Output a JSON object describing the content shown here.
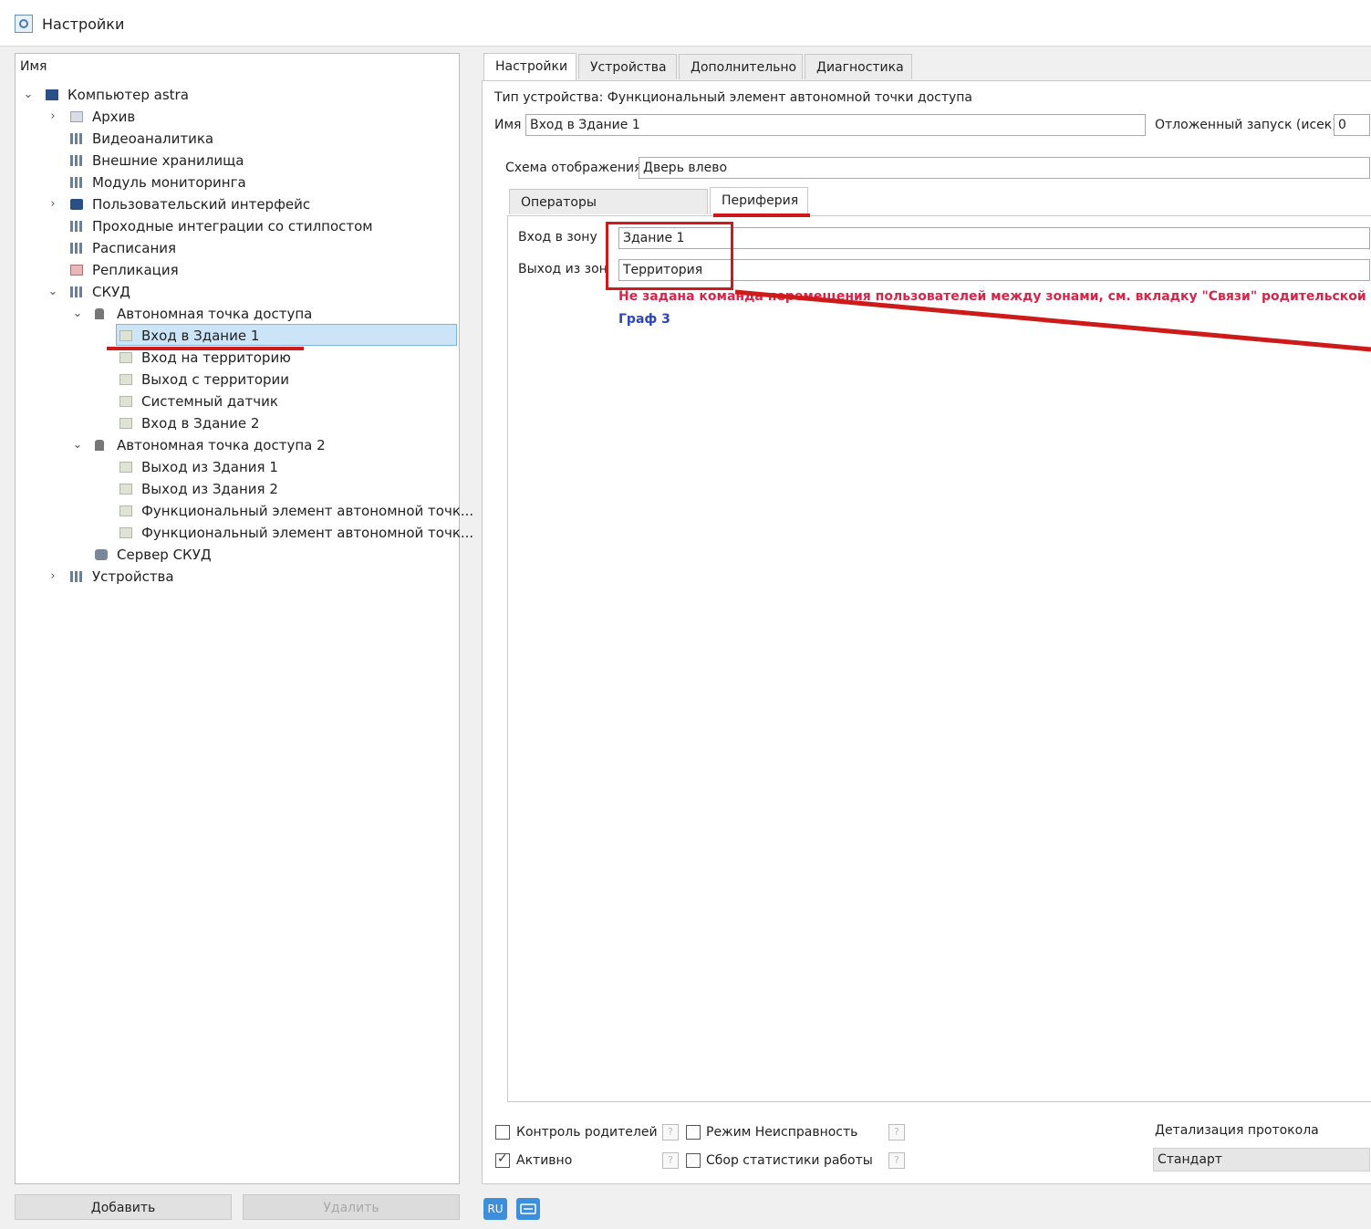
{
  "window": {
    "title": "Настройки"
  },
  "tree": {
    "header": "Имя",
    "items": [
      {
        "label": "Компьютер astra",
        "icon": "computer-icon",
        "expander": "expanded"
      },
      {
        "label": "Архив",
        "icon": "archive-icon",
        "expander": "collapsed"
      },
      {
        "label": "Видеоаналитика",
        "icon": "module-icon",
        "expander": ""
      },
      {
        "label": "Внешние хранилища",
        "icon": "module-icon",
        "expander": ""
      },
      {
        "label": "Модуль мониторинга",
        "icon": "module-icon",
        "expander": ""
      },
      {
        "label": "Пользовательский интерфейс",
        "icon": "monitor-icon",
        "expander": "collapsed"
      },
      {
        "label": "Проходные интеграции со стилпостом",
        "icon": "module-icon",
        "expander": ""
      },
      {
        "label": "Расписания",
        "icon": "module-icon",
        "expander": ""
      },
      {
        "label": "Репликация",
        "icon": "replication-icon",
        "expander": ""
      },
      {
        "label": "СКУД",
        "icon": "module-icon",
        "expander": "expanded"
      },
      {
        "label": "Автономная точка доступа",
        "icon": "access-point-icon",
        "expander": "expanded"
      },
      {
        "label": "Вход в Здание 1",
        "icon": "element-icon",
        "expander": "",
        "selected": true
      },
      {
        "label": "Вход на территорию",
        "icon": "element-icon",
        "expander": ""
      },
      {
        "label": "Выход с территории",
        "icon": "element-icon",
        "expander": ""
      },
      {
        "label": "Системный датчик",
        "icon": "element-icon",
        "expander": ""
      },
      {
        "label": "Вход в Здание 2",
        "icon": "element-icon",
        "expander": ""
      },
      {
        "label": "Автономная точка доступа 2",
        "icon": "access-point-icon",
        "expander": "expanded"
      },
      {
        "label": "Выход из Здания 1",
        "icon": "element-icon",
        "expander": ""
      },
      {
        "label": "Выход из Здания 2",
        "icon": "element-icon",
        "expander": ""
      },
      {
        "label": "Функциональный элемент автономной точк...",
        "icon": "element-icon",
        "expander": ""
      },
      {
        "label": "Функциональный элемент автономной точк...",
        "icon": "element-icon",
        "expander": ""
      },
      {
        "label": "Сервер СКУД",
        "icon": "server-icon",
        "expander": ""
      },
      {
        "label": "Устройства",
        "icon": "module-icon",
        "expander": "collapsed"
      }
    ],
    "add_button": "Добавить",
    "delete_button": "Удалить"
  },
  "tabs": [
    "Настройки",
    "Устройства",
    "Дополнительно",
    "Диагностика"
  ],
  "active_tab": "Настройки",
  "settings": {
    "device_type": "Тип устройства: Функциональный элемент автономной точки доступа",
    "name_label": "Имя",
    "name_value": "Вход в Здание 1",
    "delayed_start_label": "Отложенный запуск (исек):",
    "delayed_start_value": "0",
    "display_scheme_label": "Схема отображения",
    "display_scheme_value": "Дверь влево",
    "sub_tabs": [
      "Операторы подтверждения",
      "Периферия"
    ],
    "active_sub_tab": "Периферия",
    "zone_in_label": "Вход в зону",
    "zone_in_value": "Здание 1",
    "zone_out_label": "Выход из зоны",
    "zone_out_value": "Территория",
    "warning": "Не задана команда перемещения пользователей между зонами, см. вкладку \"Связи\" родительской точки",
    "graph_link": "Граф 3"
  },
  "bottom": {
    "parent_control_label": "Контроль родителей",
    "parent_control_checked": false,
    "fault_mode_label": "Режим Неисправность",
    "fault_mode_checked": false,
    "active_label": "Активно",
    "active_checked": true,
    "stats_label": "Сбор статистики работы",
    "stats_checked": false,
    "help_glyph": "?",
    "protocol_detail_label": "Детализация протокола",
    "protocol_detail_value": "Стандарт"
  },
  "status": {
    "lang_badge": "RU",
    "keyboard_icon": "keyboard-icon"
  },
  "colors": {
    "annotation_red": "#cf1a1a",
    "warning_text": "#d6254a",
    "link_text": "#2c46b8",
    "selection_bg": "#cce4f7"
  }
}
